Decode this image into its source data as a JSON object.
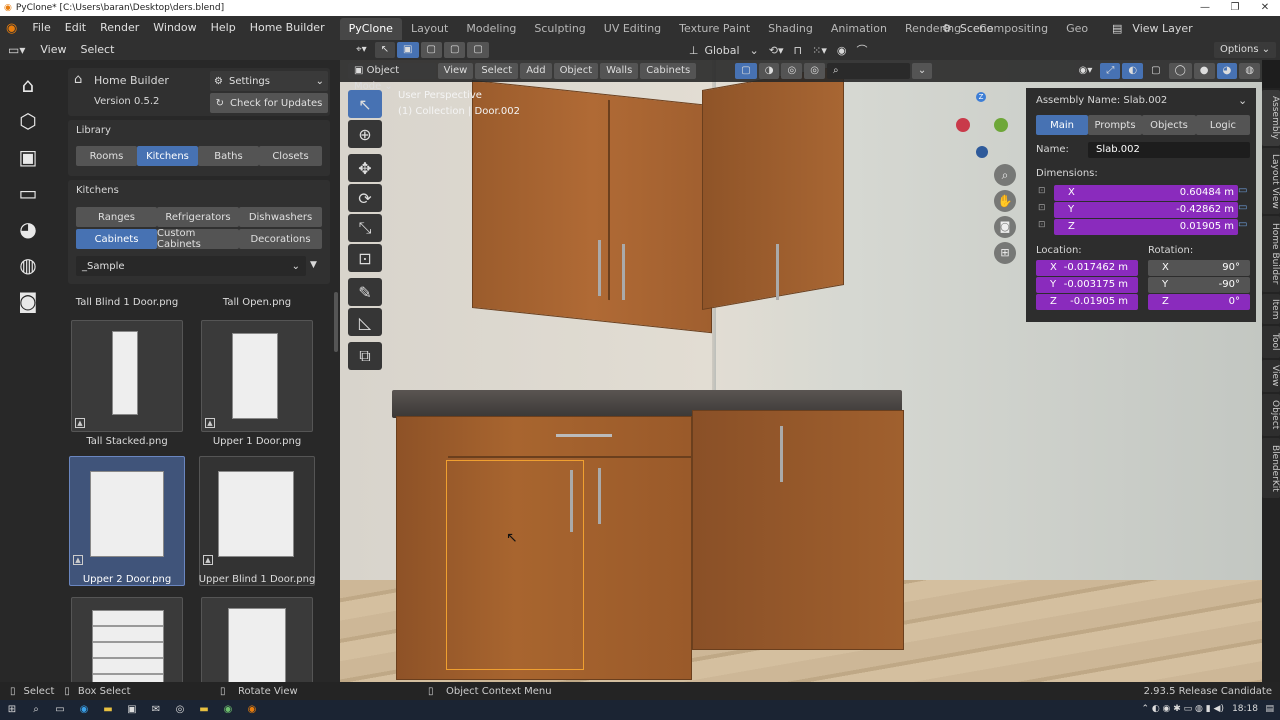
{
  "titlebar": {
    "title": "PyClone* [C:\\Users\\baran\\Desktop\\ders.blend]"
  },
  "menu": {
    "items": [
      "File",
      "Edit",
      "Render",
      "Window",
      "Help",
      "Home Builder"
    ]
  },
  "workspace_tabs": [
    "PyClone",
    "Layout",
    "Modeling",
    "Sculpting",
    "UV Editing",
    "Texture Paint",
    "Shading",
    "Animation",
    "Rendering",
    "Compositing",
    "Geo"
  ],
  "scene": {
    "name": "Scene"
  },
  "view_layer": {
    "name": "View Layer"
  },
  "left_header": {
    "view": "View",
    "select": "Select"
  },
  "addon": {
    "name": "Home Builder",
    "settings": "Settings",
    "version": "Version 0.5.2",
    "check_updates": "Check for Updates"
  },
  "library": {
    "label": "Library",
    "tabs": [
      "Rooms",
      "Kitchens",
      "Baths",
      "Closets"
    ],
    "selected": "Kitchens"
  },
  "kitchens": {
    "label": "Kitchens",
    "row1": [
      "Ranges",
      "Refrigerators",
      "Dishwashers"
    ],
    "row2": [
      "Cabinets",
      "Custom Cabinets",
      "Decorations"
    ],
    "selected": "Cabinets",
    "dropdown": "_Sample"
  },
  "assets": [
    {
      "label": "Tall Blind 1 Door.png"
    },
    {
      "label": "Tall Open.png"
    },
    {
      "label": "Tall Stacked.png"
    },
    {
      "label": "Upper 1 Door.png"
    },
    {
      "label": "Upper 2 Door.png"
    },
    {
      "label": "Upper Blind 1 Door.png"
    }
  ],
  "viewport_header": {
    "mode": "Object Mode",
    "menus": [
      "View",
      "Select",
      "Add",
      "Object",
      "Walls",
      "Cabinets"
    ],
    "transform": "Global",
    "options": "Options"
  },
  "viewport": {
    "perspective": "User Perspective",
    "collection": "(1) Collection | Door.002"
  },
  "npanel": {
    "assembly_name": "Assembly Name: Slab.002",
    "tabs": [
      "Main",
      "Prompts",
      "Objects",
      "Logic"
    ],
    "selected_tab": "Main",
    "name_label": "Name:",
    "name_value": "Slab.002",
    "dimensions_label": "Dimensions:",
    "dim_x": "0.60484 m",
    "dim_y": "-0.42862 m",
    "dim_z": "0.01905 m",
    "location_label": "Location:",
    "loc_x": "-0.017462 m",
    "loc_y": "-0.003175 m",
    "loc_z": "-0.01905 m",
    "rotation_label": "Rotation:",
    "rot_x": "90°",
    "rot_y": "-90°",
    "rot_z": "0°",
    "axis_x": "X",
    "axis_y": "Y",
    "axis_z": "Z"
  },
  "side_tabs": [
    "Assembly",
    "Layout View",
    "Home Builder",
    "Item",
    "Tool",
    "View",
    "Object",
    "BlenderKit"
  ],
  "statusbar": {
    "select": "Select",
    "box_select": "Box Select",
    "rotate_view": "Rotate View",
    "context_menu": "Object Context Menu",
    "version": "2.93.5 Release Candidate"
  },
  "taskbar": {
    "time": "18:18"
  },
  "colors": {
    "accent": "#4772b3",
    "purple_field": "#8a2bbd",
    "selection_outline": "#f0a030",
    "cabinet_wood": "#a0602e"
  }
}
